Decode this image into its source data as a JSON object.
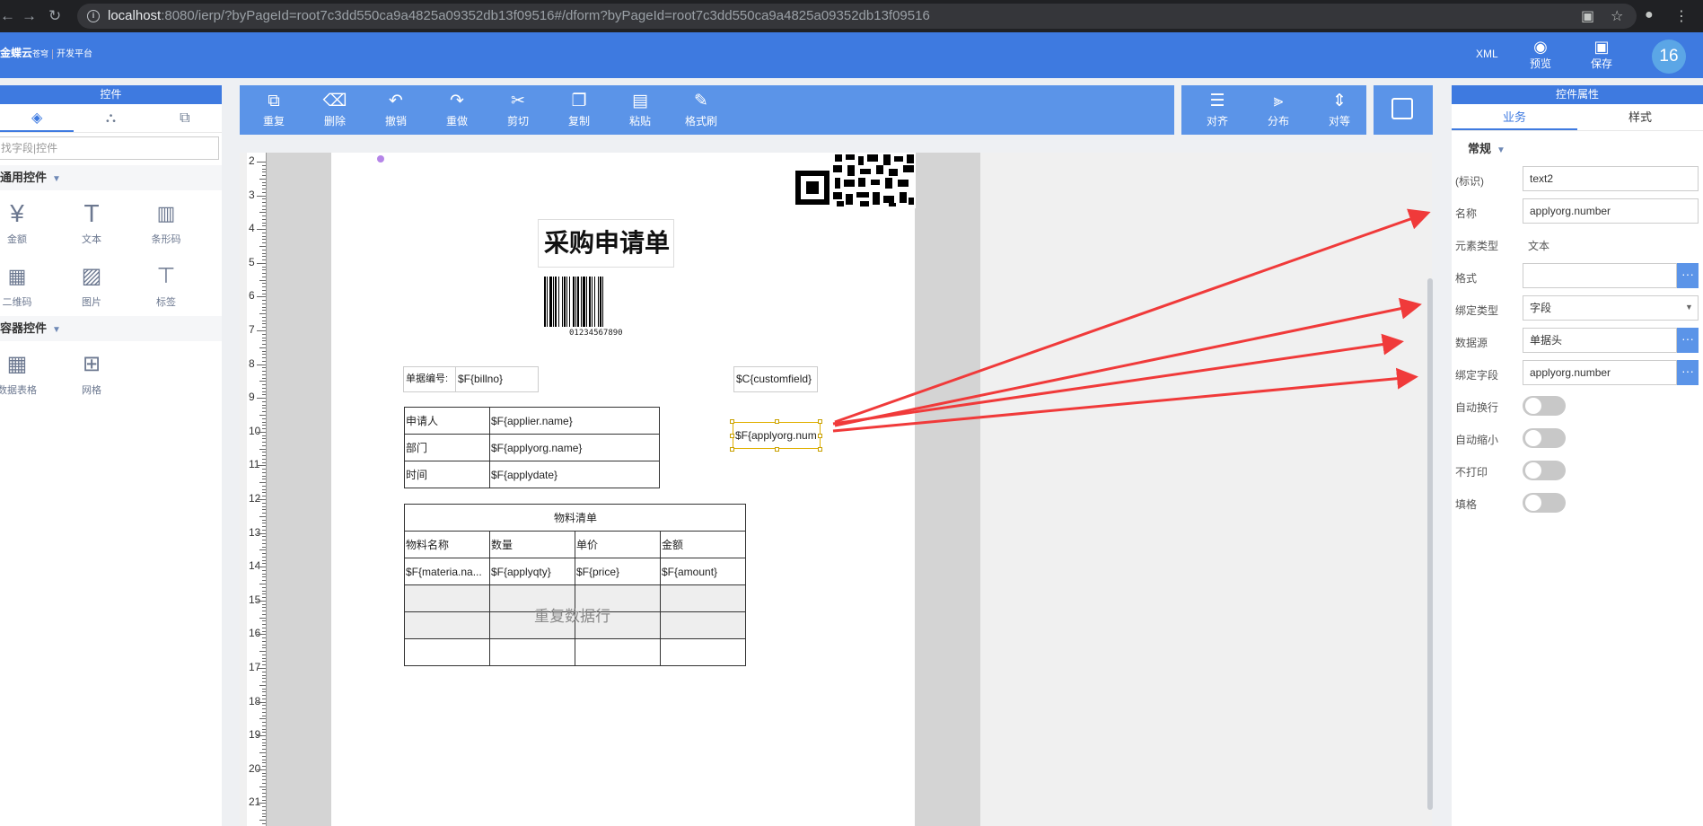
{
  "browser": {
    "url_host": "localhost",
    "url_rest": ":8080/ierp/?byPageId=root7c3dd550ca9a4825a09352db13f09516#/dform?byPageId=root7c3dd550ca9a4825a09352db13f09516"
  },
  "header": {
    "logo": "金蝶云",
    "logo_sub": "苍穹",
    "logo_tag": "开发平台",
    "xml_label": "XML",
    "preview_label": "预览",
    "save_label": "保存",
    "avatar_text": "16"
  },
  "left_panel": {
    "title": "控件",
    "search_placeholder": "找字段|控件",
    "common_section": "通用控件",
    "container_section": "容器控件",
    "common_controls": [
      {
        "label": "金额",
        "icon": "currency-icon"
      },
      {
        "label": "文本",
        "icon": "text-icon"
      },
      {
        "label": "条形码",
        "icon": "barcode-icon"
      },
      {
        "label": "二维码",
        "icon": "qrcode-icon"
      },
      {
        "label": "图片",
        "icon": "image-icon"
      },
      {
        "label": "标签",
        "icon": "label-icon"
      }
    ],
    "container_controls": [
      {
        "label": "数据表格",
        "icon": "datatable-icon"
      },
      {
        "label": "网格",
        "icon": "grid-icon"
      }
    ]
  },
  "toolbar": {
    "items": [
      "重复",
      "删除",
      "撤销",
      "重做",
      "剪切",
      "复制",
      "粘贴",
      "格式刷"
    ],
    "align": "对齐",
    "distribute": "分布",
    "equal": "对等"
  },
  "ruler": {
    "numbers": [
      "2",
      "3",
      "4",
      "5",
      "6",
      "7",
      "8",
      "9",
      "10",
      "11",
      "12",
      "13",
      "14",
      "15",
      "16",
      "17",
      "18",
      "19",
      "20",
      "21"
    ]
  },
  "canvas": {
    "title": "采购申请单",
    "barcode_text": "01234567890",
    "billno_label": "单据编号:",
    "billno_value": "$F{billno}",
    "customfield": "$C{customfield}",
    "selected_field": "$F{applyorg.num",
    "info_table": [
      [
        "申请人",
        "$F{applier.name}"
      ],
      [
        "部门",
        "$F{applyorg.name}"
      ],
      [
        "时间",
        "$F{applydate}"
      ]
    ],
    "material_title": "物料清单",
    "material_headers": [
      "物料名称",
      "数量",
      "单价",
      "金额"
    ],
    "material_row": [
      "$F{materia.na...",
      "$F{applyqty}",
      "$F{price}",
      "$F{amount}"
    ],
    "repeat_label": "重复数据行"
  },
  "right_panel": {
    "title": "控件属性",
    "tab_business": "业务",
    "tab_style": "样式",
    "section": "常规",
    "fields": [
      {
        "label": "(标识)",
        "value": "text2"
      },
      {
        "label": "名称",
        "value": "applyorg.number"
      },
      {
        "label": "元素类型",
        "value": "文本"
      },
      {
        "label": "格式",
        "value": ""
      },
      {
        "label": "绑定类型",
        "value": "字段"
      },
      {
        "label": "数据源",
        "value": "单据头"
      },
      {
        "label": "绑定字段",
        "value": "applyorg.number"
      }
    ],
    "toggles": [
      "自动换行",
      "自动缩小",
      "不打印",
      "填格"
    ]
  },
  "colors": {
    "brand_blue": "#3e7ae0",
    "toolbar_blue": "#5b94e8",
    "arrow_red": "#f03a3a"
  }
}
